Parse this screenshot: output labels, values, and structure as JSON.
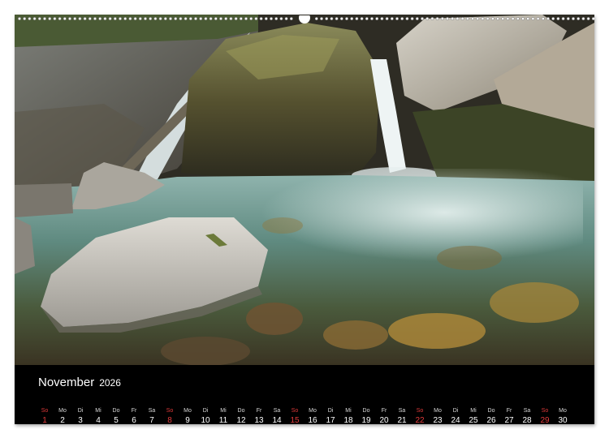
{
  "calendar": {
    "month": "November",
    "year": "2026",
    "sunday_color": "#e03a3a",
    "days": [
      {
        "wd": "So",
        "d": "1",
        "sun": true
      },
      {
        "wd": "Mo",
        "d": "2"
      },
      {
        "wd": "Di",
        "d": "3"
      },
      {
        "wd": "Mi",
        "d": "4"
      },
      {
        "wd": "Do",
        "d": "5"
      },
      {
        "wd": "Fr",
        "d": "6"
      },
      {
        "wd": "Sa",
        "d": "7"
      },
      {
        "wd": "So",
        "d": "8",
        "sun": true
      },
      {
        "wd": "Mo",
        "d": "9"
      },
      {
        "wd": "Di",
        "d": "10"
      },
      {
        "wd": "Mi",
        "d": "11"
      },
      {
        "wd": "Do",
        "d": "12"
      },
      {
        "wd": "Fr",
        "d": "13"
      },
      {
        "wd": "Sa",
        "d": "14"
      },
      {
        "wd": "So",
        "d": "15",
        "sun": true
      },
      {
        "wd": "Mo",
        "d": "16"
      },
      {
        "wd": "Di",
        "d": "17"
      },
      {
        "wd": "Mi",
        "d": "18"
      },
      {
        "wd": "Do",
        "d": "19"
      },
      {
        "wd": "Fr",
        "d": "20"
      },
      {
        "wd": "Sa",
        "d": "21"
      },
      {
        "wd": "So",
        "d": "22",
        "sun": true
      },
      {
        "wd": "Mo",
        "d": "23"
      },
      {
        "wd": "Di",
        "d": "24"
      },
      {
        "wd": "Mi",
        "d": "25"
      },
      {
        "wd": "Do",
        "d": "26"
      },
      {
        "wd": "Fr",
        "d": "27"
      },
      {
        "wd": "Sa",
        "d": "28"
      },
      {
        "wd": "So",
        "d": "29",
        "sun": true
      },
      {
        "wd": "Mo",
        "d": "30"
      }
    ]
  },
  "photo": {
    "subject": "waterfall-pool-photo"
  }
}
